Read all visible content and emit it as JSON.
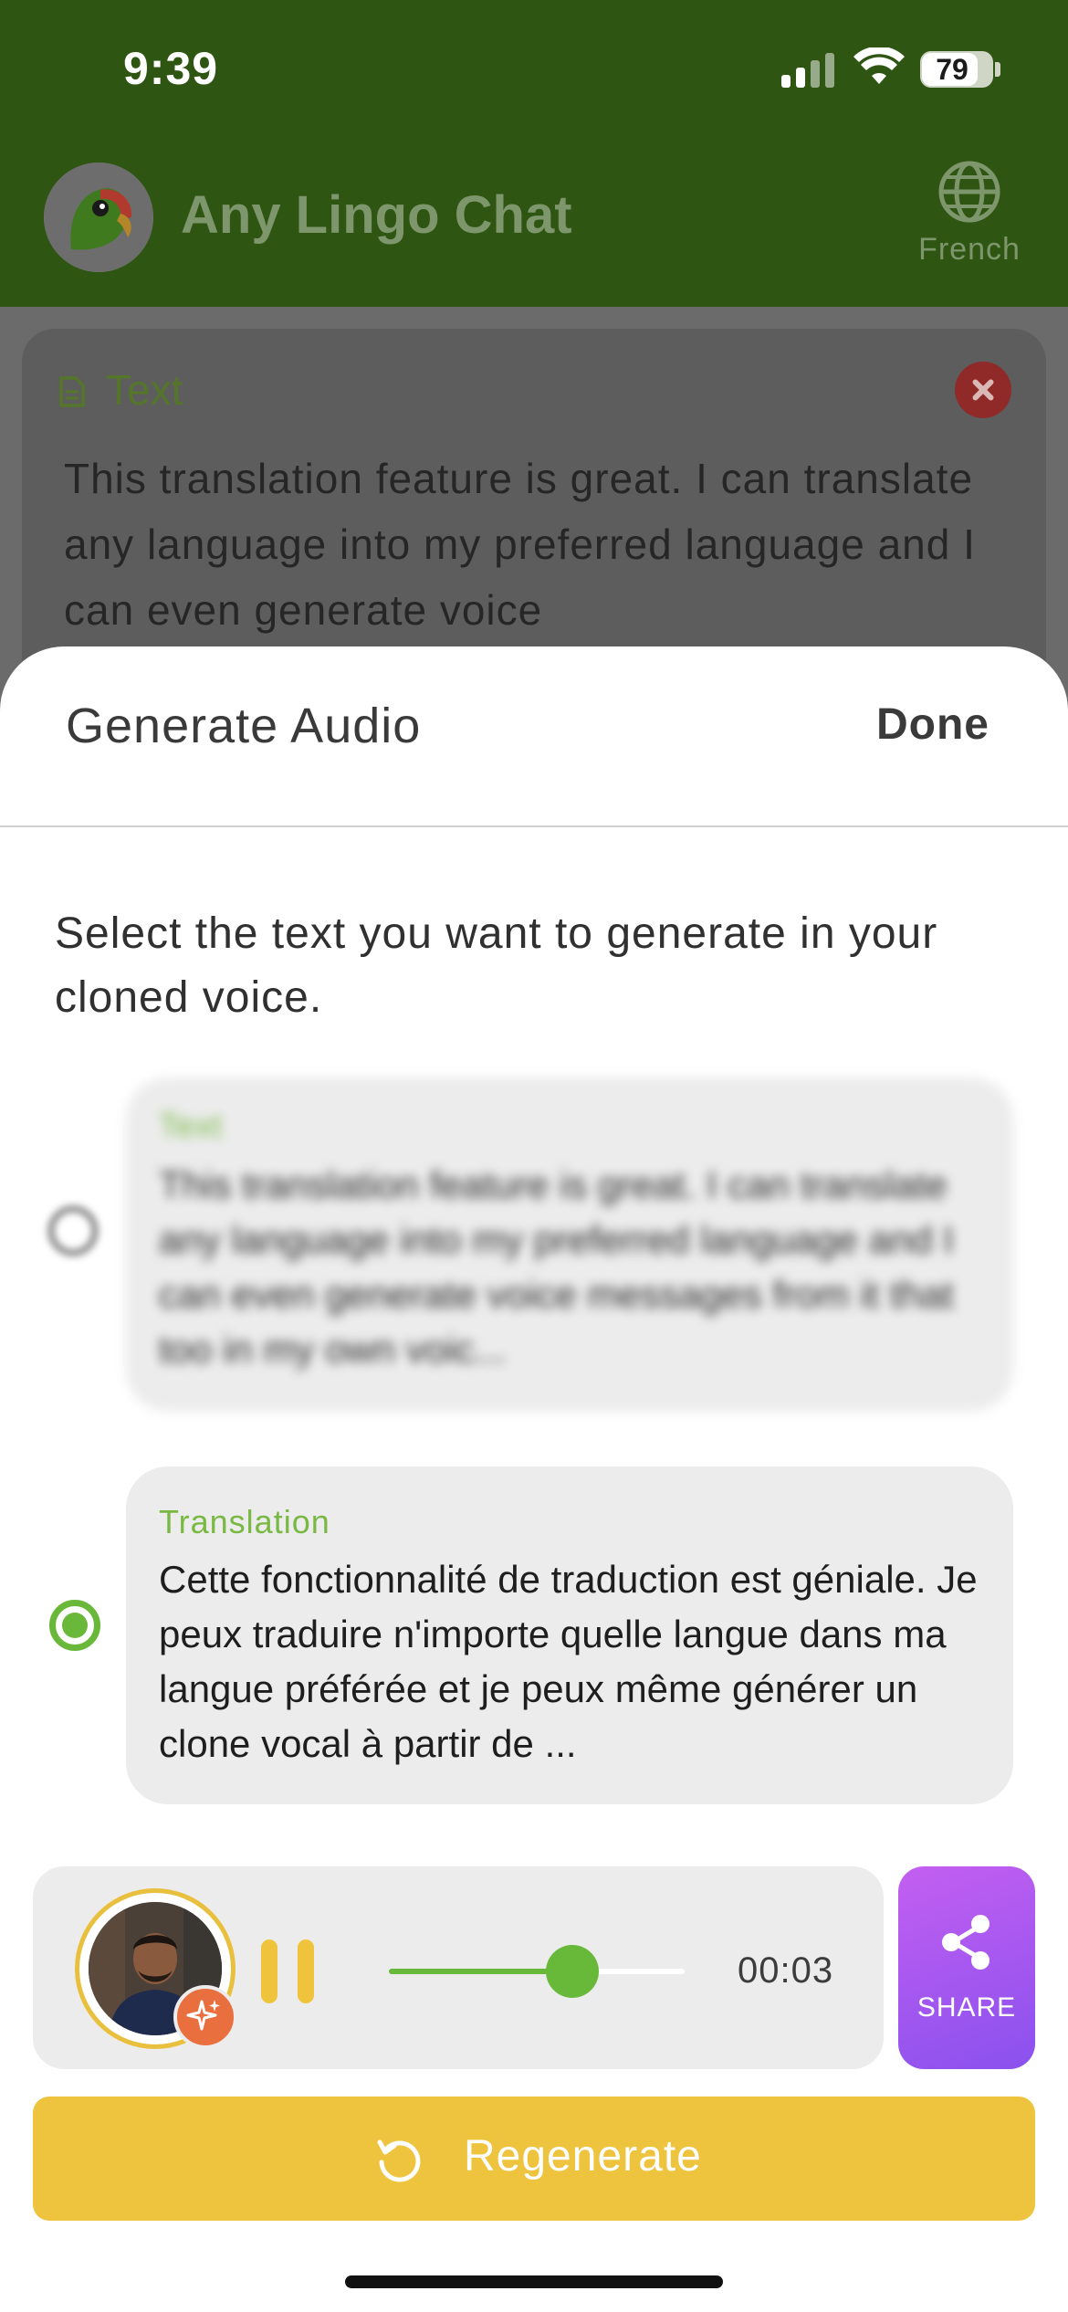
{
  "status_bar": {
    "time": "9:39",
    "battery": "79",
    "icons": [
      "signal-icon",
      "wifi-icon",
      "battery-icon"
    ]
  },
  "header": {
    "title": "Any Lingo Chat",
    "language_label": "French",
    "icons": [
      "parrot-logo-icon",
      "globe-icon"
    ]
  },
  "text_card": {
    "label": "Text",
    "body": "This translation feature is great. I can translate any language into my preferred language and I can even generate voice",
    "icons": [
      "document-icon",
      "close-icon"
    ]
  },
  "sheet": {
    "title": "Generate Audio",
    "done_label": "Done",
    "instruction": "Select the text you want to generate in your cloned voice.",
    "options": [
      {
        "label": "Text",
        "body": "This translation feature is great. I can translate any language into my preferred language and I can even generate voice messages from it that too in my own voic...",
        "selected": false
      },
      {
        "label": "Translation",
        "body": "Cette fonctionnalité de traduction est géniale. Je peux traduire n'importe quelle langue dans ma langue préférée et je peux même générer un clone vocal à partir de ...",
        "selected": true
      }
    ]
  },
  "player": {
    "time": "00:03",
    "progress": 0.62,
    "icons": [
      "avatar-photo",
      "sparkle-icon",
      "pause-icon"
    ]
  },
  "share": {
    "label": "SHARE",
    "icon": "share-icon"
  },
  "regenerate": {
    "label": "Regenerate",
    "icon": "refresh-icon"
  },
  "colors": {
    "header_green": "#2f5513",
    "accent_green": "#68b83a",
    "regenerate_yellow": "#eec33e",
    "share_purple": "#a558f0",
    "sparkle_orange": "#ea6f3f"
  }
}
